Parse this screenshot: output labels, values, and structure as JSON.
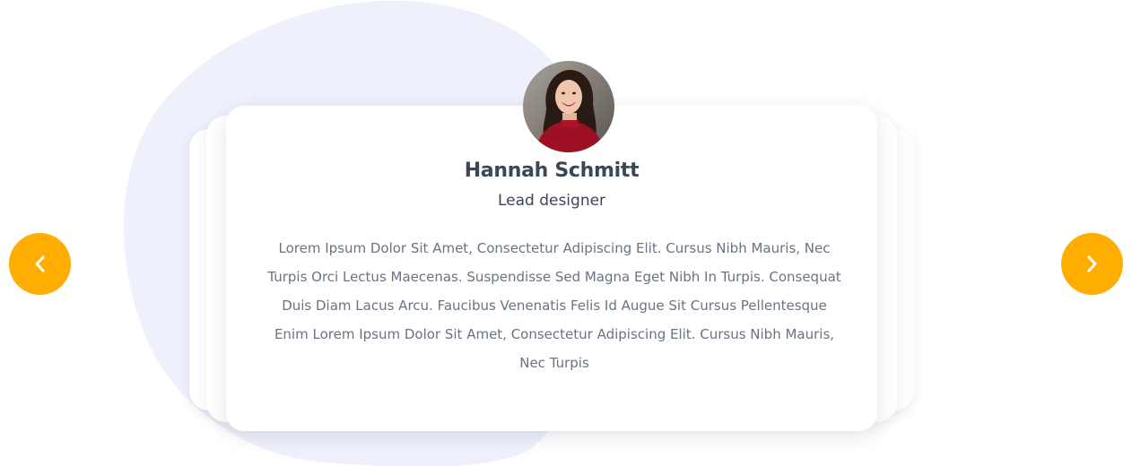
{
  "theme": {
    "accent": "#ffad00",
    "blob": "#eef0fb",
    "text_dark": "#3b4656",
    "text_muted": "#6a7382"
  },
  "testimonial": {
    "name": "Hannah Schmitt",
    "role": "Lead designer",
    "quote": "Lorem Ipsum Dolor Sit Amet, Consectetur Adipiscing Elit. Cursus Nibh Mauris, Nec Turpis Orci Lectus Maecenas. Suspendisse Sed Magna Eget Nibh In Turpis. Consequat Duis Diam Lacus Arcu. Faucibus Venenatis Felis Id Augue Sit Cursus Pellentesque Enim Lorem Ipsum Dolor Sit Amet, Consectetur Adipiscing Elit. Cursus Nibh Mauris, Nec Turpis"
  },
  "controls": {
    "prev_icon": "chevron-left-icon",
    "next_icon": "chevron-right-icon"
  }
}
